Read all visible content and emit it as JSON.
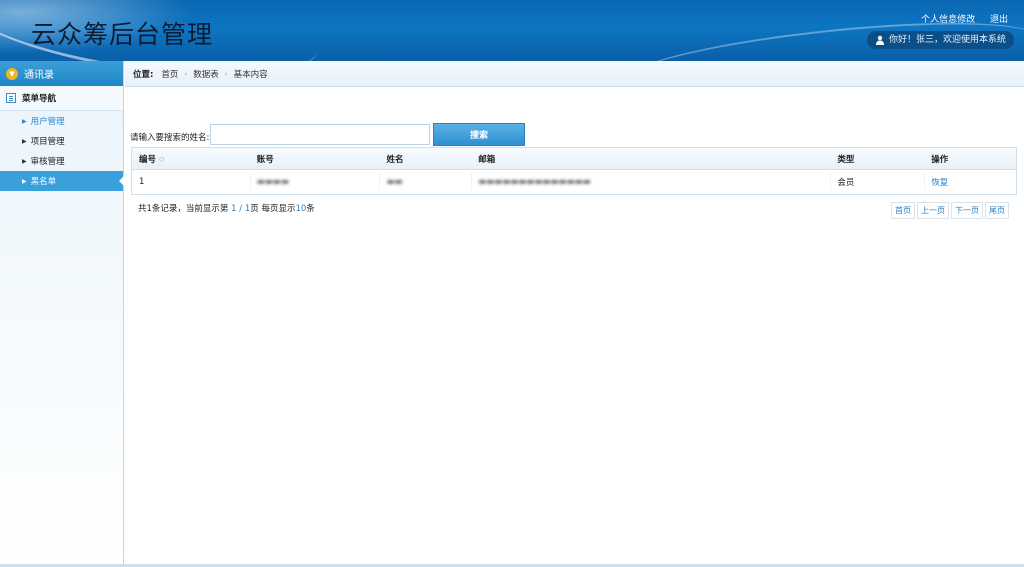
{
  "header": {
    "title": "云众筹后台管理",
    "links": [
      "个人信息修改",
      "退出"
    ],
    "welcome": "你好！张三，欢迎使用本系统"
  },
  "sidebar": {
    "top_label": "通讯录",
    "nav_title": "菜单导航",
    "items": [
      {
        "label": "用户管理"
      },
      {
        "label": "项目管理"
      },
      {
        "label": "审核管理"
      },
      {
        "label": "黑名单"
      }
    ]
  },
  "breadcrumb": {
    "label": "位置:",
    "items": [
      "首页",
      "数据表",
      "基本内容"
    ]
  },
  "search": {
    "label": "请输入要搜索的姓名:",
    "value": "",
    "placeholder": "",
    "button": "搜索"
  },
  "table": {
    "columns": [
      "编号",
      "账号",
      "姓名",
      "邮箱",
      "类型",
      "操作"
    ],
    "rows": [
      {
        "id": "1",
        "account": "",
        "name": "",
        "email": "",
        "type": "会员",
        "action": "恢复"
      }
    ]
  },
  "pagination": {
    "prefix": "共1条记录，当前显示第 ",
    "current": "1",
    "slash": " / ",
    "total": "1",
    "middle": "页 每页显示",
    "per_page": "10",
    "suffix": "条",
    "buttons": [
      "首页",
      "上一页",
      "下一页",
      "尾页"
    ]
  },
  "colors": {
    "header_blue": "#0d75c2",
    "accent": "#3aa0dc",
    "link": "#2a7fc4"
  }
}
